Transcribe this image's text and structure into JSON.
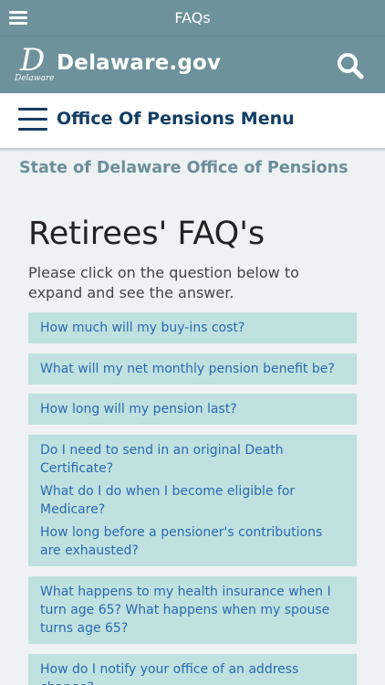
{
  "topbar": {
    "title": "FAQs",
    "menu_icon": "hamburger-menu-icon"
  },
  "brand": {
    "logo_letter": "D",
    "logo_word": "Delaware",
    "site_name": "Delaware.gov",
    "search_icon": "search-icon"
  },
  "subnav": {
    "label": "Office Of Pensions Menu"
  },
  "office_title": "State of Delaware Office of Pensions",
  "page": {
    "heading": "Retirees' FAQ's",
    "intro": "Please click on the question below to expand and see the answer."
  },
  "faqs": [
    "How much will my buy-ins cost?",
    "What will my net monthly pension benefit be?",
    "How long will my pension last?",
    "Do I need to send in an original Death Certificate?",
    "What do I do when I become eligible for Medicare?",
    "How long before a pensioner's contributions are exhausted?",
    "What happens to my health insurance when I turn age 65? What happens when my spouse turns age 65?",
    "How do I notify your office of an address change?"
  ],
  "colors": {
    "header": "#6e929c",
    "navy": "#123d64",
    "faq_bg": "#bfe1e0",
    "faq_text": "#2a6ab0",
    "page_bg": "#eef2f4"
  }
}
